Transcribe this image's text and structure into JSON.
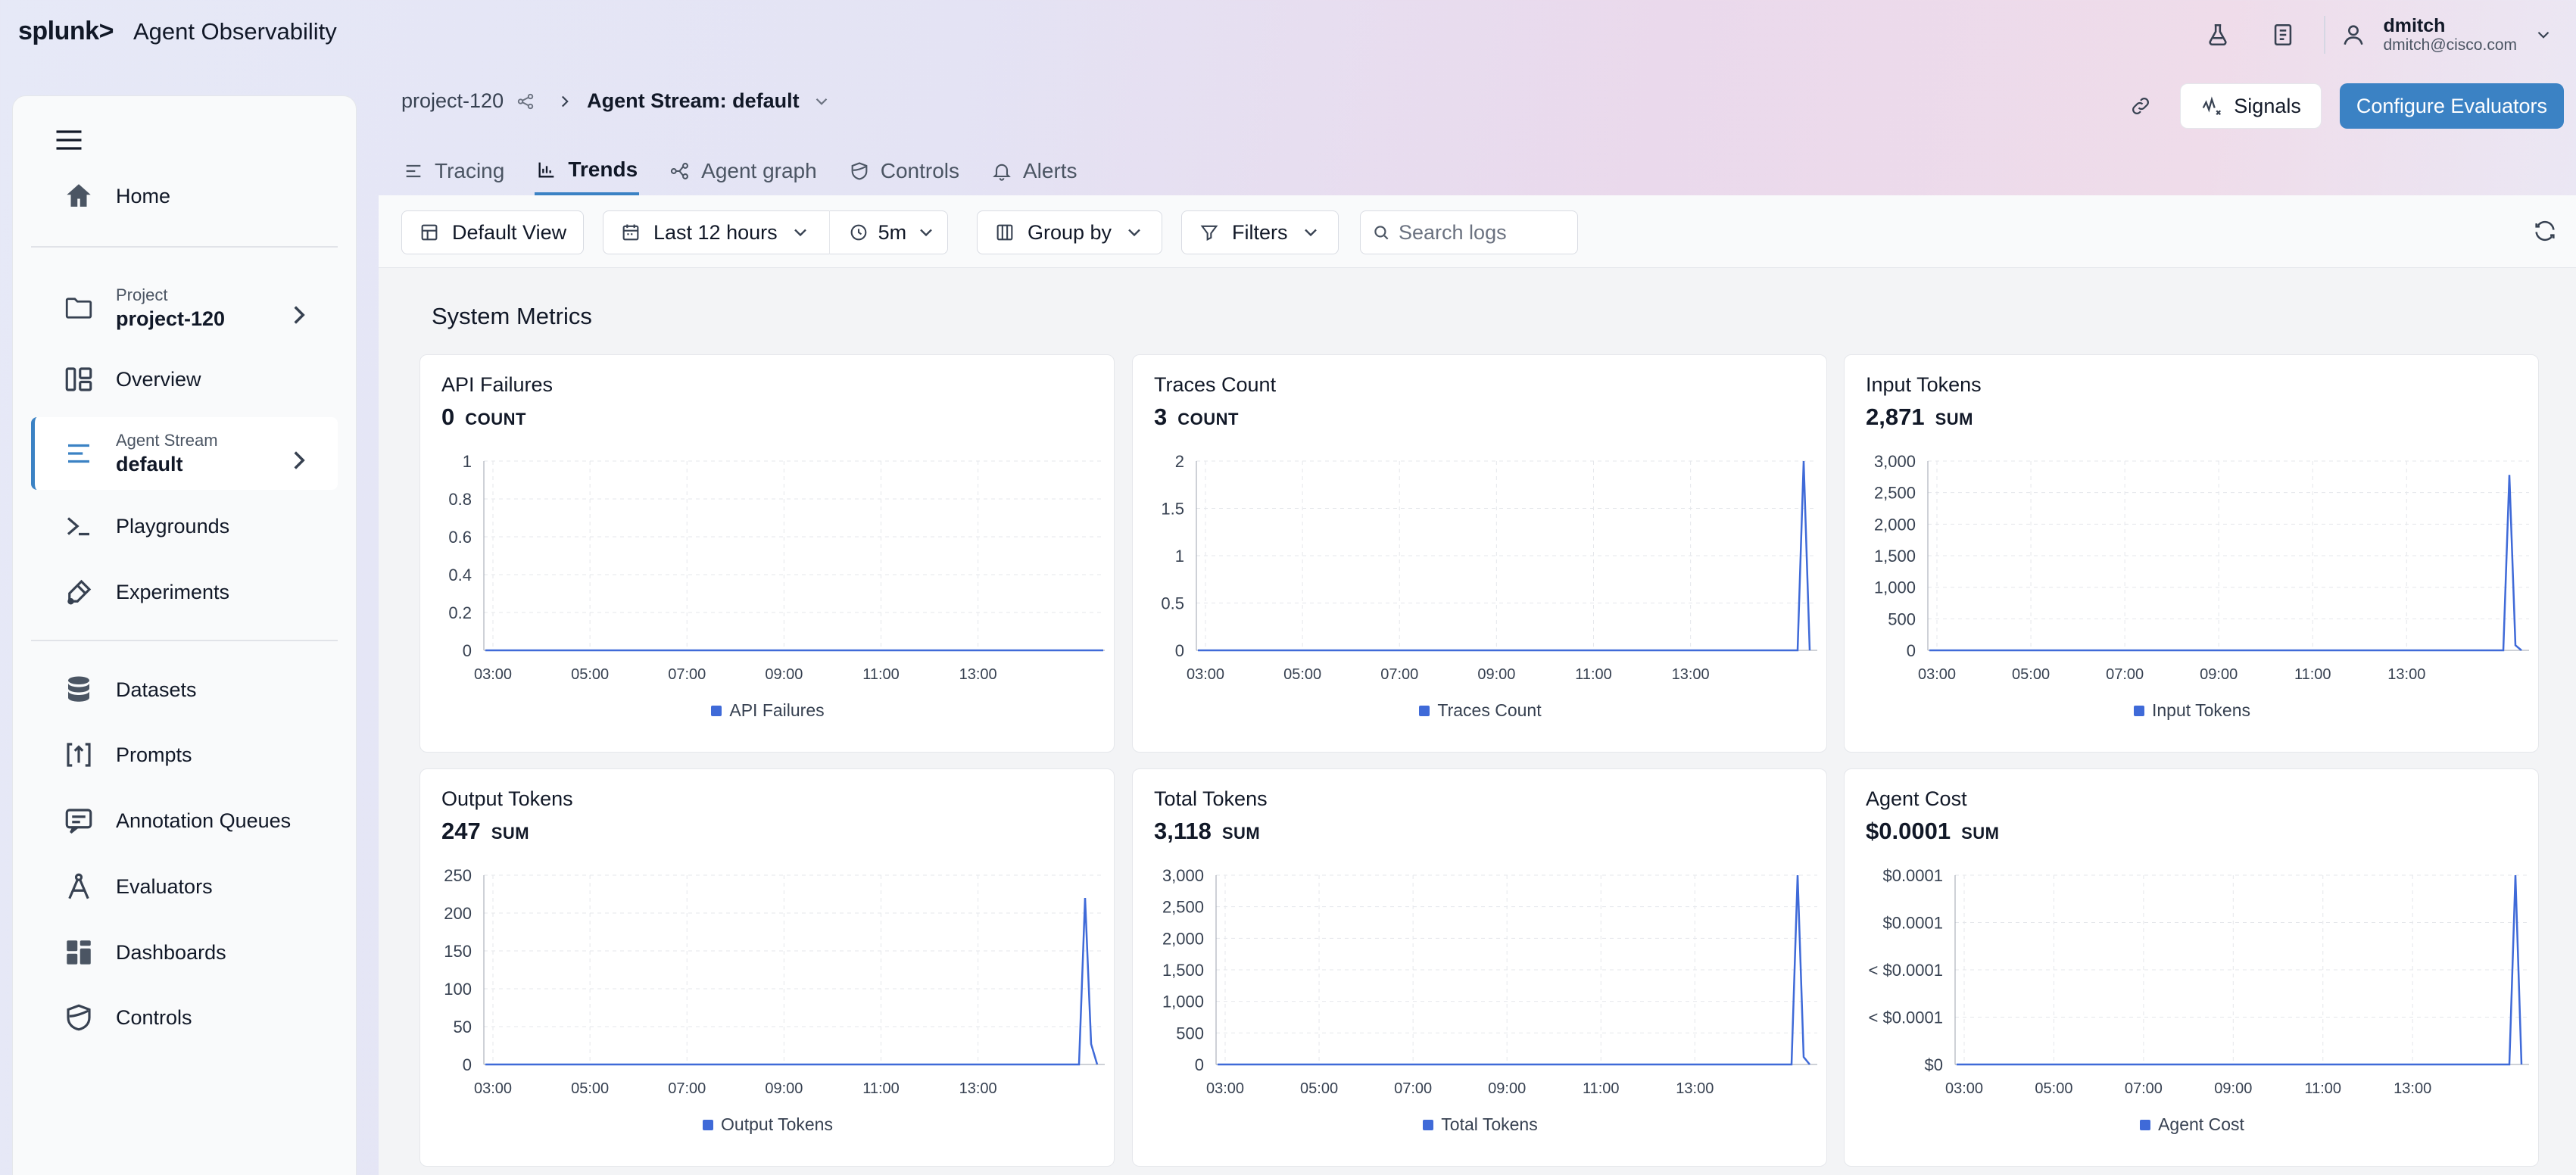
{
  "app": {
    "logo": "splunk>",
    "title": "Agent Observability"
  },
  "user": {
    "name": "dmitch",
    "email": "dmitch@cisco.com"
  },
  "topbar_icons": [
    "flask-icon",
    "book-icon",
    "user-icon",
    "chevron-down-icon"
  ],
  "sidebar": {
    "home": "Home",
    "project": {
      "label": "Project",
      "value": "project-120"
    },
    "overview": "Overview",
    "stream": {
      "label": "Agent Stream",
      "value": "default"
    },
    "playgrounds": "Playgrounds",
    "experiments": "Experiments",
    "datasets": "Datasets",
    "prompts": "Prompts",
    "annotation_queues": "Annotation Queues",
    "evaluators": "Evaluators",
    "dashboards": "Dashboards",
    "controls": "Controls"
  },
  "breadcrumb": {
    "project": "project-120",
    "stream": "Agent Stream: default"
  },
  "header": {
    "signals": "Signals",
    "configure": "Configure Evaluators"
  },
  "tabs": [
    {
      "label": "Tracing",
      "icon": "list-icon"
    },
    {
      "label": "Trends",
      "icon": "bar-chart-icon"
    },
    {
      "label": "Agent graph",
      "icon": "graph-icon"
    },
    {
      "label": "Controls",
      "icon": "shield-icon"
    },
    {
      "label": "Alerts",
      "icon": "bell-icon"
    }
  ],
  "toolbar": {
    "view": "Default View",
    "range": "Last 12 hours",
    "interval": "5m",
    "group_by": "Group by",
    "filters": "Filters",
    "search_placeholder": "Search logs"
  },
  "section_title": "System Metrics",
  "accent_color": "#3b82c4",
  "series_color": "#3f6ad8",
  "chart_data": [
    {
      "type": "line",
      "title": "API Failures",
      "total": "0",
      "agg": "COUNT",
      "x": [
        "03:00",
        "05:00",
        "07:00",
        "09:00",
        "11:00",
        "13:00"
      ],
      "yticks": [
        "0",
        "0.2",
        "0.4",
        "0.6",
        "0.8",
        "1"
      ],
      "ylim": [
        0,
        1
      ],
      "series": [
        {
          "name": "API Failures",
          "values": [
            0,
            0
          ]
        }
      ],
      "grid": true,
      "legend": "bottom"
    },
    {
      "type": "line",
      "title": "Traces Count",
      "total": "3",
      "agg": "COUNT",
      "x": [
        "03:00",
        "05:00",
        "07:00",
        "09:00",
        "11:00",
        "13:00"
      ],
      "yticks": [
        "0",
        "0.5",
        "1",
        "1.5",
        "2"
      ],
      "ylim": [
        0,
        2
      ],
      "series": [
        {
          "name": "Traces Count",
          "values": [
            0,
            0,
            2,
            0
          ]
        }
      ],
      "grid": true,
      "legend": "bottom"
    },
    {
      "type": "line",
      "title": "Input Tokens",
      "total": "2,871",
      "agg": "SUM",
      "x": [
        "03:00",
        "05:00",
        "07:00",
        "09:00",
        "11:00",
        "13:00"
      ],
      "yticks": [
        "0",
        "500",
        "1,000",
        "1,500",
        "2,000",
        "2,500",
        "3,000"
      ],
      "ylim": [
        0,
        3000
      ],
      "series": [
        {
          "name": "Input Tokens",
          "values": [
            0,
            0,
            2780,
            80,
            0
          ]
        }
      ],
      "grid": true,
      "legend": "bottom"
    },
    {
      "type": "line",
      "title": "Output Tokens",
      "total": "247",
      "agg": "SUM",
      "x": [
        "03:00",
        "05:00",
        "07:00",
        "09:00",
        "11:00",
        "13:00"
      ],
      "yticks": [
        "0",
        "50",
        "100",
        "150",
        "200",
        "250"
      ],
      "ylim": [
        0,
        250
      ],
      "series": [
        {
          "name": "Output Tokens",
          "values": [
            0,
            0,
            220,
            27,
            0
          ]
        }
      ],
      "grid": true,
      "legend": "bottom"
    },
    {
      "type": "line",
      "title": "Total Tokens",
      "total": "3,118",
      "agg": "SUM",
      "x": [
        "03:00",
        "05:00",
        "07:00",
        "09:00",
        "11:00",
        "13:00"
      ],
      "yticks": [
        "0",
        "500",
        "1,000",
        "1,500",
        "2,000",
        "2,500",
        "3,000"
      ],
      "ylim": [
        0,
        3000
      ],
      "series": [
        {
          "name": "Total Tokens",
          "values": [
            0,
            0,
            3000,
            118,
            0
          ]
        }
      ],
      "grid": true,
      "legend": "bottom"
    },
    {
      "type": "line",
      "title": "Agent Cost",
      "total": "$0.0001",
      "agg": "SUM",
      "x": [
        "03:00",
        "05:00",
        "07:00",
        "09:00",
        "11:00",
        "13:00"
      ],
      "yticks": [
        "$0",
        "< $0.0001",
        "< $0.0001",
        "$0.0001",
        "$0.0001"
      ],
      "ylim": [
        0,
        4
      ],
      "series": [
        {
          "name": "Agent Cost",
          "values": [
            0,
            0,
            4,
            0
          ]
        }
      ],
      "grid": true,
      "legend": "bottom"
    }
  ]
}
